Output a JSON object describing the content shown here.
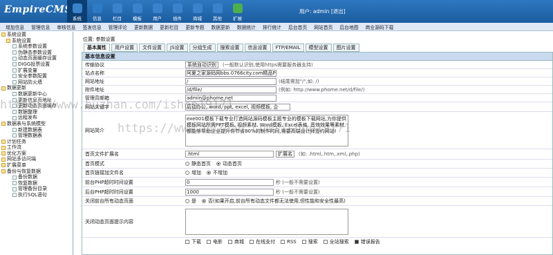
{
  "logo": "EmpireCMS",
  "nav": [
    {
      "label": "系统",
      "icon": "system-icon",
      "color": "#3a82cc"
    },
    {
      "label": "信息",
      "icon": "info-icon",
      "color": "#2f7ac4"
    },
    {
      "label": "栏目",
      "icon": "column-icon",
      "color": "#3a82cc"
    },
    {
      "label": "模板",
      "icon": "template-icon",
      "color": "#3a82cc"
    },
    {
      "label": "用户",
      "icon": "user-icon",
      "color": "#3a82cc"
    },
    {
      "label": "插件",
      "icon": "plugin-icon",
      "color": "#3a82cc"
    },
    {
      "label": "商城",
      "icon": "shop-icon",
      "color": "#3a82cc"
    },
    {
      "label": "其他",
      "icon": "other-icon",
      "color": "#3a82cc"
    },
    {
      "label": "扩展",
      "icon": "extend-icon",
      "color": "#4caf50"
    }
  ],
  "user": {
    "text": "用户: admin",
    "logout": "[退出]"
  },
  "subnav": [
    "增加信息",
    "管理信息",
    "审核信息",
    "签发信息",
    "管理评论",
    "更新数据",
    "更新栏目",
    "更新专题",
    "数据更新",
    "数据统计",
    "排行统计",
    "后台首页",
    "网站首页",
    "后台地图",
    "商业源码下载"
  ],
  "sidebar": [
    {
      "label": "系统设置",
      "level": 0
    },
    {
      "label": "系统设置",
      "level": 0,
      "indent": 1
    },
    {
      "label": "系统参数设置",
      "level": 1
    },
    {
      "label": "伪静态参数设置",
      "level": 1
    },
    {
      "label": "动态页面缓存设置",
      "level": 1
    },
    {
      "label": "DIGG投票设置",
      "level": 1
    },
    {
      "label": "扩展变量",
      "level": 1
    },
    {
      "label": "安全参数配置",
      "level": 1
    },
    {
      "label": "网站防火墙",
      "level": 1
    },
    {
      "label": "数据更新",
      "level": 0
    },
    {
      "label": "数据更新中心",
      "level": 1
    },
    {
      "label": "更新信息页地址",
      "level": 1
    },
    {
      "label": "更新动态页面缓存",
      "level": 1
    },
    {
      "label": "数据整理",
      "level": 1
    },
    {
      "label": "远程发布",
      "level": 1
    },
    {
      "label": "数据表与系统模型",
      "level": 0
    },
    {
      "label": "新建数据表",
      "level": 1
    },
    {
      "label": "管理数据表",
      "level": 1
    },
    {
      "label": "计划任务",
      "level": 0
    },
    {
      "label": "工作流",
      "level": 0
    },
    {
      "label": "优化方案",
      "level": 0
    },
    {
      "label": "网站多访问端",
      "level": 0
    },
    {
      "label": "扩展菜单",
      "level": 0
    },
    {
      "label": "备份与恢复数据",
      "level": 0
    },
    {
      "label": "备份数据",
      "level": 1
    },
    {
      "label": "恢复数据",
      "level": 1
    },
    {
      "label": "管理备份目录",
      "level": 1
    },
    {
      "label": "执行SQL语句",
      "level": 1
    }
  ],
  "breadcrumb": "位置: 参数设置",
  "tabs": [
    "基本属性",
    "用户设置",
    "文件设置",
    "JS设置",
    "分组生成",
    "搜索设置",
    "信息设置",
    "FTP/EMAIL",
    "模型设置",
    "图片设置"
  ],
  "panel_title": "基本信息设置",
  "form": {
    "transfer": {
      "label": "传输协议",
      "value": "系统自动识别",
      "hint": "(一般默认识别,使用https需要服务器支持)"
    },
    "sitename": {
      "label": "站点名称",
      "value": "阿夏之家源码网bbs.0766city.com精品PPT模"
    },
    "siteurl": {
      "label": "网站地址",
      "value": "/",
      "hint": "(结尾需加\"/\",如: /)"
    },
    "attachurl": {
      "label": "附件地址",
      "value": "/d/file/",
      "hint": "(例如: http://www.phome.net/d/file/)"
    },
    "email": {
      "label": "管理员邮箱",
      "value": "admin@phome.net"
    },
    "keywords": {
      "label": "网站关键字",
      "value": "后动办公, word, ppt, excel, 视频模板, 企"
    },
    "intro": {
      "label": "网站简介",
      "value": "exe001模板下载专业打造网站源码模板主题专业的模板下载网站,为你提供模板网站所需PPT模板, 视频素材, Word模板, Excel表格, 音效效果等素材,都能够帮助企业提升你节省80%的制作时间,需要高端设计师签约网站!"
    },
    "ext": {
      "label": "首页文件扩展名",
      "value": ".html",
      "select": "扩展名",
      "hint": "(如: .html,.htm,.xml,.php)"
    },
    "homemode": {
      "label": "首页模式",
      "opt1": "静态首页",
      "opt2": "动态首页"
    },
    "homelink": {
      "label": "首页链接加文件名",
      "opt1": "增加",
      "opt2": "不增加"
    },
    "frontphp": {
      "label": "前台PHP超时时间设置",
      "value": "0",
      "hint": "秒 (一般不需要设置)"
    },
    "backphp": {
      "label": "后台PHP超时时间设置",
      "value": "1000",
      "hint": "秒 (一般不需要设置)"
    },
    "closedyn": {
      "label": "关闭前台所有动态页面",
      "opt1": "是",
      "opt2": "否",
      "hint": "(如果开启,前台所有动态文件都无法使用,但性能和安全性最高)"
    },
    "closetip": {
      "label": "关闭动态页面提示内容"
    },
    "closemod": {
      "items": [
        "下载",
        "电影",
        "商城",
        "在线支付",
        "RSS",
        "搜索",
        "全站搜索",
        "错误报告"
      ]
    }
  },
  "watermark": "https://www.huzhan.com/ishop19171"
}
